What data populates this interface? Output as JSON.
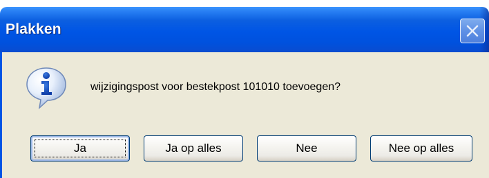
{
  "dialog": {
    "title": "Plakken",
    "message": "wijzigingspost voor bestekpost 101010 toevoegen?",
    "icon": "information-icon",
    "buttons": {
      "yes": "Ja",
      "yes_all": "Ja op alles",
      "no": "Nee",
      "no_all": "Nee op alles"
    },
    "default_button": "yes"
  },
  "colors": {
    "titlebar": "#0055e5",
    "dialog_background": "#ece9d8",
    "button_border": "#003c74"
  }
}
